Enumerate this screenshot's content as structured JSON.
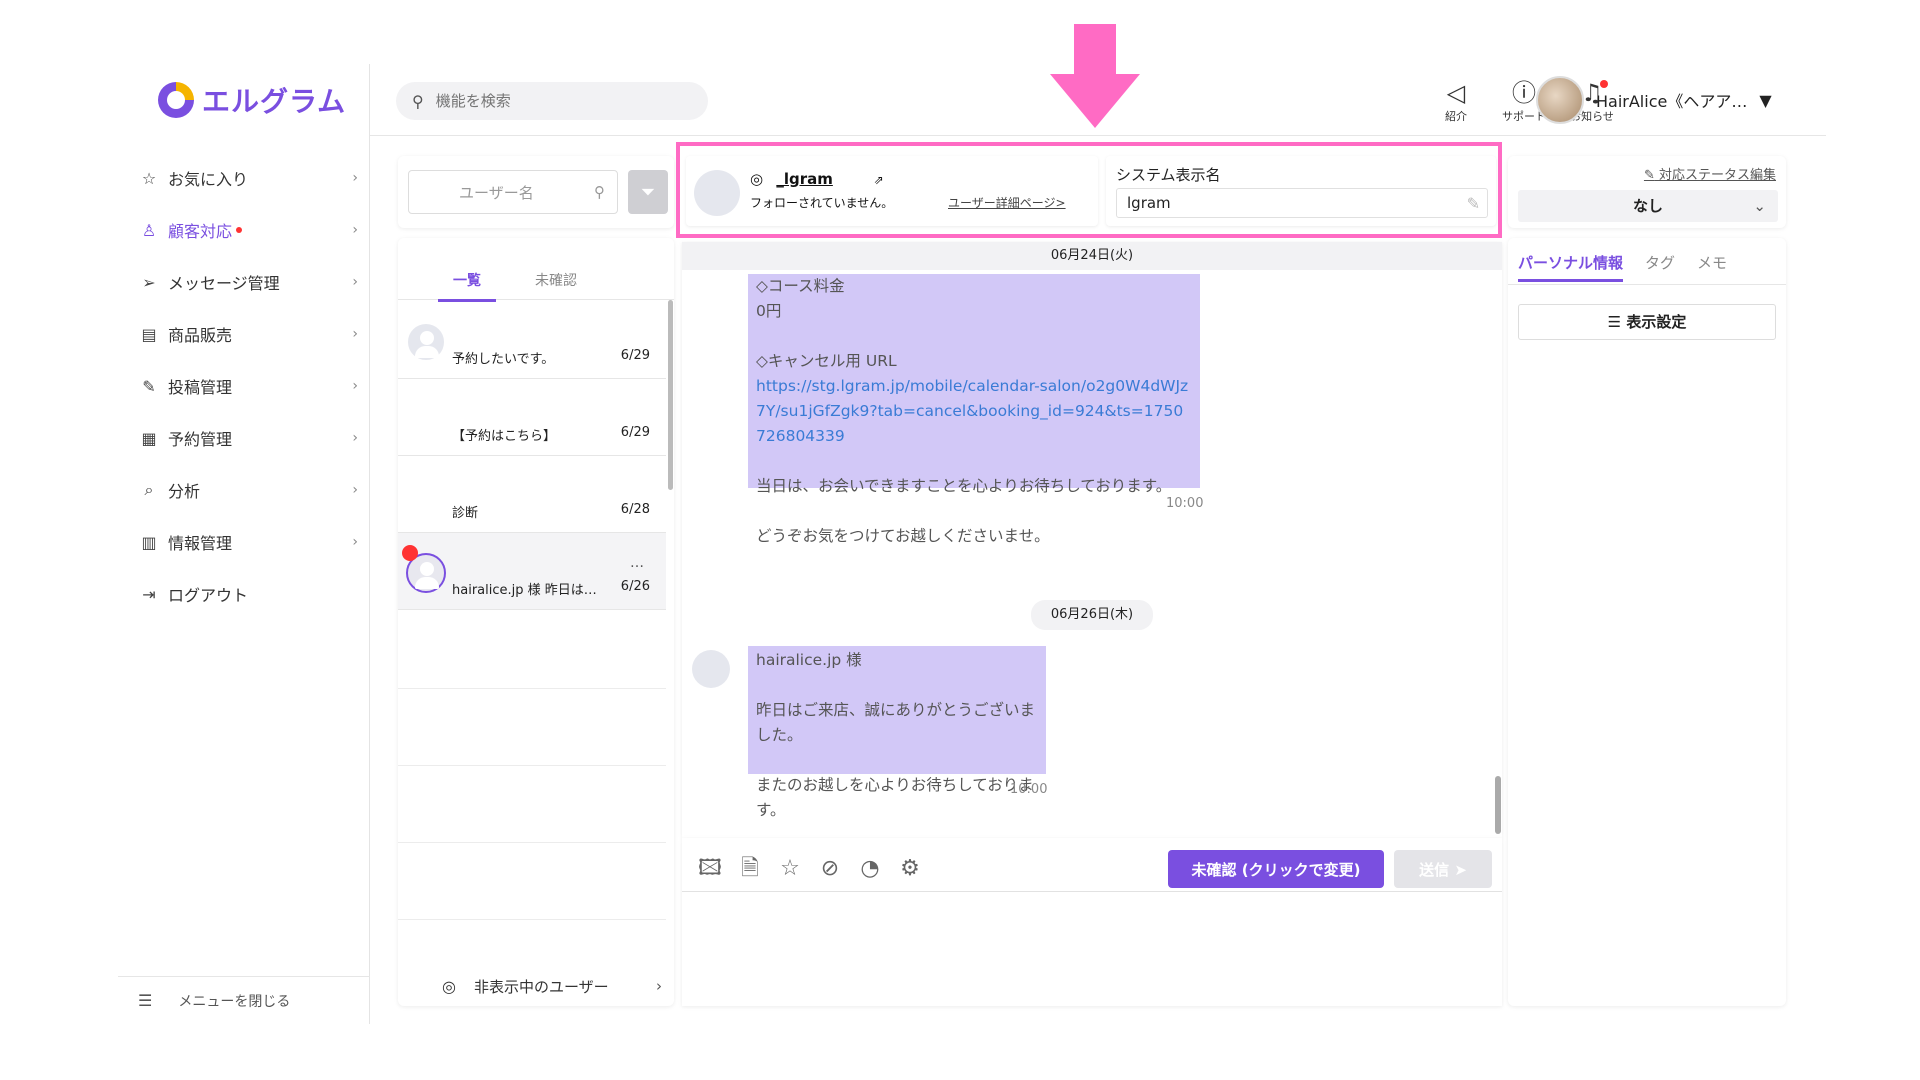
{
  "brand": {
    "name": "エルグラム",
    "colors": {
      "accent": "#7a4fe0",
      "highlight": "#ff6bc4",
      "bubble": "#d2c8f7",
      "notify": "#ff3333"
    }
  },
  "nav": {
    "items": [
      {
        "label": "お気に入り",
        "icon": "star-icon"
      },
      {
        "label": "顧客対応",
        "icon": "person-icon"
      },
      {
        "label": "メッセージ管理",
        "icon": "send-icon"
      },
      {
        "label": "商品販売",
        "icon": "store-icon"
      },
      {
        "label": "投稿管理",
        "icon": "edit-icon"
      },
      {
        "label": "予約管理",
        "icon": "calendar-icon"
      },
      {
        "label": "分析",
        "icon": "analysis-icon"
      },
      {
        "label": "情報管理",
        "icon": "chart-icon"
      },
      {
        "label": "ログアウト",
        "icon": "logout-icon"
      }
    ],
    "close_label": "メニューを閉じる"
  },
  "topbar": {
    "search_placeholder": "機能を検索",
    "icons": [
      {
        "label": "紹介",
        "icon": "megaphone-icon"
      },
      {
        "label": "サポート",
        "icon": "help-icon"
      },
      {
        "label": "お知らせ",
        "icon": "bell-icon"
      }
    ],
    "user_name": "HairAlice《ヘアア…"
  },
  "convlist": {
    "search_placeholder": "ユーザー名",
    "tabs": [
      "一覧",
      "未確認"
    ],
    "items": [
      {
        "text": "予約したいです。",
        "date": "6/29"
      },
      {
        "text": "【予約はこちら】",
        "date": "6/29"
      },
      {
        "text": "診断",
        "date": "6/28"
      },
      {
        "text": "hairalice.jp 様 昨日は…",
        "date": "6/26",
        "more": "…"
      }
    ],
    "hidden_users_label": "非表示中のユーザー"
  },
  "chat_header": {
    "handle": "_lgram",
    "follow_status": "フォローされていません。",
    "detail_link": "ユーザー詳細ページ>",
    "system_name_label": "システム表示名",
    "system_name_value": "lgram"
  },
  "chat": {
    "date1": "06月24日(火)",
    "msg1_part1": "◇コース料金\n0円\n\n◇キャンセル用 URL",
    "msg1_link": "https://stg.lgram.jp/mobile/calendar-salon/o2g0W4dWJz7Y/su1jGfZgk9?tab=cancel&booking_id=924&ts=1750726804339",
    "msg1_part2": "当日は、お会いできますことを心よりお待ちしております。\n\nどうぞお気をつけてお越しくださいませ。",
    "time1": "10:00",
    "date2": "06月26日(木)",
    "msg2": "hairalice.jp 様\n\n昨日はご来店、誠にありがとうございました。\n\nまたのお越しを心よりお待ちしております。",
    "time2": "10:00"
  },
  "composer": {
    "tools": [
      "image-icon",
      "document-icon",
      "star-icon",
      "hide-icon",
      "timer-icon",
      "settings-icon"
    ],
    "unread_button": "未確認 (クリックで変更)",
    "send_button": "送信"
  },
  "right_panel": {
    "status_edit": "対応ステータス編集",
    "status_value": "なし",
    "tabs": [
      "パーソナル情報",
      "タグ",
      "メモ"
    ],
    "display_settings": "表示設定"
  }
}
